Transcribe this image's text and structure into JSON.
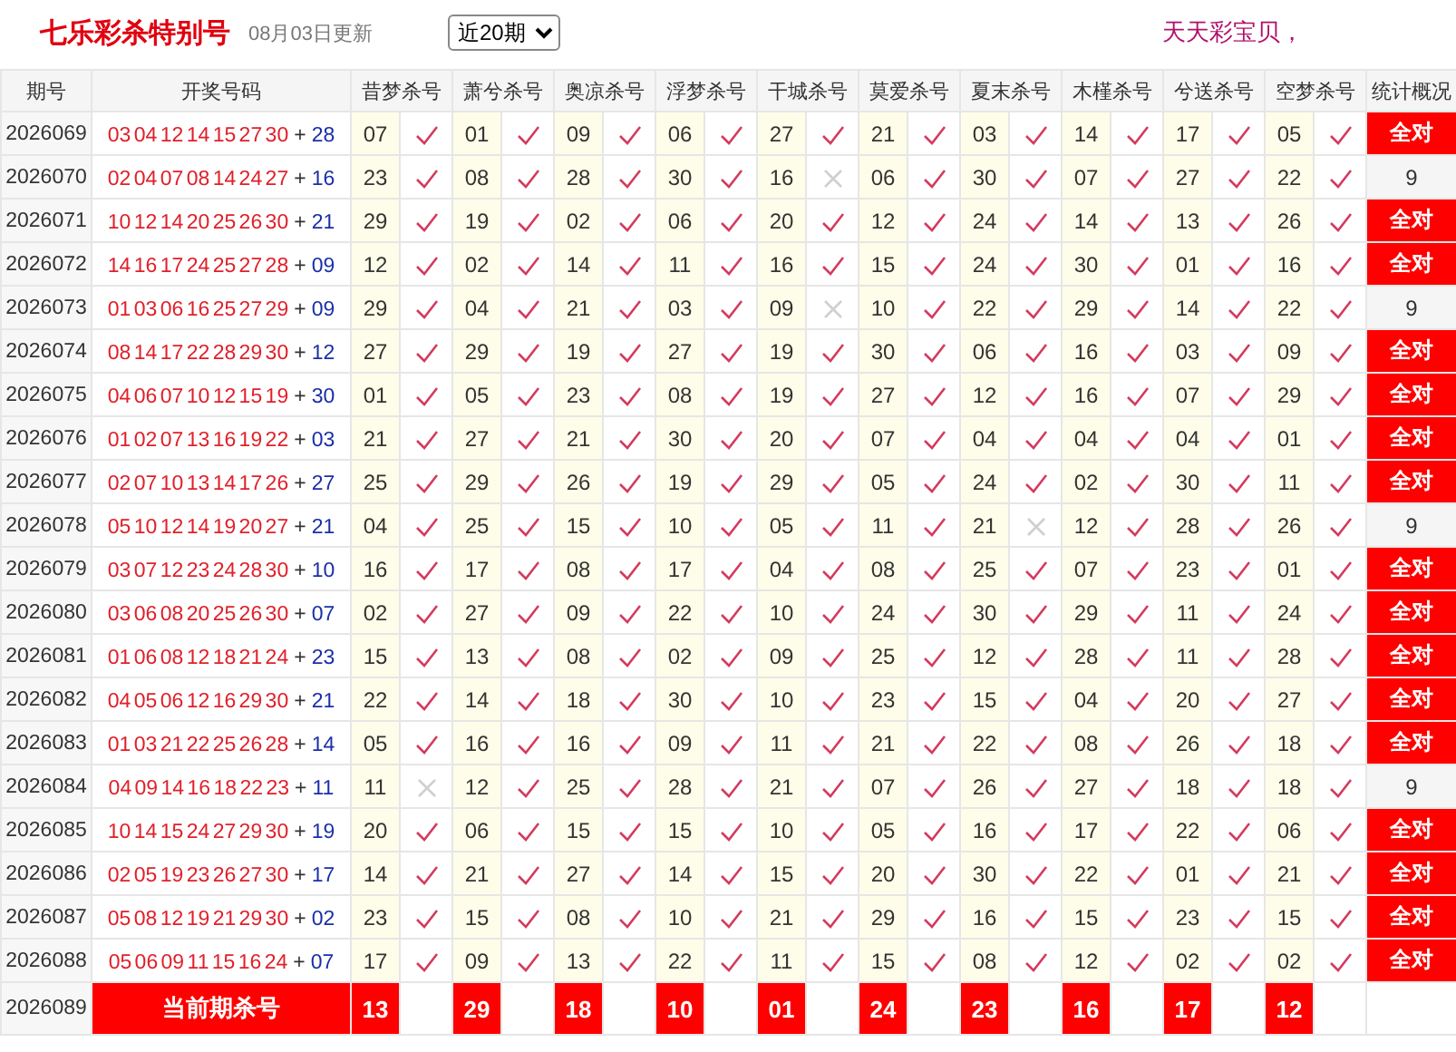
{
  "header": {
    "title": "七乐彩杀特别号",
    "updated": "08月03日更新",
    "period_select": "近20期",
    "slogan": "天天彩宝贝，"
  },
  "columns": [
    "期号",
    "开奖号码",
    "昔梦杀号",
    "萧兮杀号",
    "奥凉杀号",
    "浮梦杀号",
    "干城杀号",
    "莫爱杀号",
    "夏末杀号",
    "木槿杀号",
    "兮送杀号",
    "空梦杀号",
    "统计概况"
  ],
  "rows": [
    {
      "issue": "2026069",
      "main": "03 04 12 14 15 27 30",
      "plus": "+",
      "special": "28",
      "kills": [
        {
          "num": "07",
          "hit": true
        },
        {
          "num": "01",
          "hit": true
        },
        {
          "num": "09",
          "hit": true
        },
        {
          "num": "06",
          "hit": true
        },
        {
          "num": "27",
          "hit": true
        },
        {
          "num": "21",
          "hit": true
        },
        {
          "num": "03",
          "hit": true
        },
        {
          "num": "14",
          "hit": true
        },
        {
          "num": "17",
          "hit": true
        },
        {
          "num": "05",
          "hit": true
        }
      ],
      "summary": {
        "kind": "all",
        "text": "全对"
      }
    },
    {
      "issue": "2026070",
      "main": "02 04 07 08 14 24 27",
      "plus": "+",
      "special": "16",
      "kills": [
        {
          "num": "23",
          "hit": true
        },
        {
          "num": "08",
          "hit": true
        },
        {
          "num": "28",
          "hit": true
        },
        {
          "num": "30",
          "hit": true
        },
        {
          "num": "16",
          "hit": false
        },
        {
          "num": "06",
          "hit": true
        },
        {
          "num": "30",
          "hit": true
        },
        {
          "num": "07",
          "hit": true
        },
        {
          "num": "27",
          "hit": true
        },
        {
          "num": "22",
          "hit": true
        }
      ],
      "summary": {
        "kind": "count",
        "text": "9"
      }
    },
    {
      "issue": "2026071",
      "main": "10 12 14 20 25 26 30",
      "plus": "+",
      "special": "21",
      "kills": [
        {
          "num": "29",
          "hit": true
        },
        {
          "num": "19",
          "hit": true
        },
        {
          "num": "02",
          "hit": true
        },
        {
          "num": "06",
          "hit": true
        },
        {
          "num": "20",
          "hit": true
        },
        {
          "num": "12",
          "hit": true
        },
        {
          "num": "24",
          "hit": true
        },
        {
          "num": "14",
          "hit": true
        },
        {
          "num": "13",
          "hit": true
        },
        {
          "num": "26",
          "hit": true
        }
      ],
      "summary": {
        "kind": "all",
        "text": "全对"
      }
    },
    {
      "issue": "2026072",
      "main": "14 16 17 24 25 27 28",
      "plus": "+",
      "special": "09",
      "kills": [
        {
          "num": "12",
          "hit": true
        },
        {
          "num": "02",
          "hit": true
        },
        {
          "num": "14",
          "hit": true
        },
        {
          "num": "11",
          "hit": true
        },
        {
          "num": "16",
          "hit": true
        },
        {
          "num": "15",
          "hit": true
        },
        {
          "num": "24",
          "hit": true
        },
        {
          "num": "30",
          "hit": true
        },
        {
          "num": "01",
          "hit": true
        },
        {
          "num": "16",
          "hit": true
        }
      ],
      "summary": {
        "kind": "all",
        "text": "全对"
      }
    },
    {
      "issue": "2026073",
      "main": "01 03 06 16 25 27 29",
      "plus": "+",
      "special": "09",
      "kills": [
        {
          "num": "29",
          "hit": true
        },
        {
          "num": "04",
          "hit": true
        },
        {
          "num": "21",
          "hit": true
        },
        {
          "num": "03",
          "hit": true
        },
        {
          "num": "09",
          "hit": false
        },
        {
          "num": "10",
          "hit": true
        },
        {
          "num": "22",
          "hit": true
        },
        {
          "num": "29",
          "hit": true
        },
        {
          "num": "14",
          "hit": true
        },
        {
          "num": "22",
          "hit": true
        }
      ],
      "summary": {
        "kind": "count",
        "text": "9"
      }
    },
    {
      "issue": "2026074",
      "main": "08 14 17 22 28 29 30",
      "plus": "+",
      "special": "12",
      "kills": [
        {
          "num": "27",
          "hit": true
        },
        {
          "num": "29",
          "hit": true
        },
        {
          "num": "19",
          "hit": true
        },
        {
          "num": "27",
          "hit": true
        },
        {
          "num": "19",
          "hit": true
        },
        {
          "num": "30",
          "hit": true
        },
        {
          "num": "06",
          "hit": true
        },
        {
          "num": "16",
          "hit": true
        },
        {
          "num": "03",
          "hit": true
        },
        {
          "num": "09",
          "hit": true
        }
      ],
      "summary": {
        "kind": "all",
        "text": "全对"
      }
    },
    {
      "issue": "2026075",
      "main": "04 06 07 10 12 15 19",
      "plus": "+",
      "special": "30",
      "kills": [
        {
          "num": "01",
          "hit": true
        },
        {
          "num": "05",
          "hit": true
        },
        {
          "num": "23",
          "hit": true
        },
        {
          "num": "08",
          "hit": true
        },
        {
          "num": "19",
          "hit": true
        },
        {
          "num": "27",
          "hit": true
        },
        {
          "num": "12",
          "hit": true
        },
        {
          "num": "16",
          "hit": true
        },
        {
          "num": "07",
          "hit": true
        },
        {
          "num": "29",
          "hit": true
        }
      ],
      "summary": {
        "kind": "all",
        "text": "全对"
      }
    },
    {
      "issue": "2026076",
      "main": "01 02 07 13 16 19 22",
      "plus": "+",
      "special": "03",
      "kills": [
        {
          "num": "21",
          "hit": true
        },
        {
          "num": "27",
          "hit": true
        },
        {
          "num": "21",
          "hit": true
        },
        {
          "num": "30",
          "hit": true
        },
        {
          "num": "20",
          "hit": true
        },
        {
          "num": "07",
          "hit": true
        },
        {
          "num": "04",
          "hit": true
        },
        {
          "num": "04",
          "hit": true
        },
        {
          "num": "04",
          "hit": true
        },
        {
          "num": "01",
          "hit": true
        }
      ],
      "summary": {
        "kind": "all",
        "text": "全对"
      }
    },
    {
      "issue": "2026077",
      "main": "02 07 10 13 14 17 26",
      "plus": "+",
      "special": "27",
      "kills": [
        {
          "num": "25",
          "hit": true
        },
        {
          "num": "29",
          "hit": true
        },
        {
          "num": "26",
          "hit": true
        },
        {
          "num": "19",
          "hit": true
        },
        {
          "num": "29",
          "hit": true
        },
        {
          "num": "05",
          "hit": true
        },
        {
          "num": "24",
          "hit": true
        },
        {
          "num": "02",
          "hit": true
        },
        {
          "num": "30",
          "hit": true
        },
        {
          "num": "11",
          "hit": true
        }
      ],
      "summary": {
        "kind": "all",
        "text": "全对"
      }
    },
    {
      "issue": "2026078",
      "main": "05 10 12 14 19 20 27",
      "plus": "+",
      "special": "21",
      "kills": [
        {
          "num": "04",
          "hit": true
        },
        {
          "num": "25",
          "hit": true
        },
        {
          "num": "15",
          "hit": true
        },
        {
          "num": "10",
          "hit": true
        },
        {
          "num": "05",
          "hit": true
        },
        {
          "num": "11",
          "hit": true
        },
        {
          "num": "21",
          "hit": false
        },
        {
          "num": "12",
          "hit": true
        },
        {
          "num": "28",
          "hit": true
        },
        {
          "num": "26",
          "hit": true
        }
      ],
      "summary": {
        "kind": "count",
        "text": "9"
      }
    },
    {
      "issue": "2026079",
      "main": "03 07 12 23 24 28 30",
      "plus": "+",
      "special": "10",
      "kills": [
        {
          "num": "16",
          "hit": true
        },
        {
          "num": "17",
          "hit": true
        },
        {
          "num": "08",
          "hit": true
        },
        {
          "num": "17",
          "hit": true
        },
        {
          "num": "04",
          "hit": true
        },
        {
          "num": "08",
          "hit": true
        },
        {
          "num": "25",
          "hit": true
        },
        {
          "num": "07",
          "hit": true
        },
        {
          "num": "23",
          "hit": true
        },
        {
          "num": "01",
          "hit": true
        }
      ],
      "summary": {
        "kind": "all",
        "text": "全对"
      }
    },
    {
      "issue": "2026080",
      "main": "03 06 08 20 25 26 30",
      "plus": "+",
      "special": "07",
      "kills": [
        {
          "num": "02",
          "hit": true
        },
        {
          "num": "27",
          "hit": true
        },
        {
          "num": "09",
          "hit": true
        },
        {
          "num": "22",
          "hit": true
        },
        {
          "num": "10",
          "hit": true
        },
        {
          "num": "24",
          "hit": true
        },
        {
          "num": "30",
          "hit": true
        },
        {
          "num": "29",
          "hit": true
        },
        {
          "num": "11",
          "hit": true
        },
        {
          "num": "24",
          "hit": true
        }
      ],
      "summary": {
        "kind": "all",
        "text": "全对"
      }
    },
    {
      "issue": "2026081",
      "main": "01 06 08 12 18 21 24",
      "plus": "+",
      "special": "23",
      "kills": [
        {
          "num": "15",
          "hit": true
        },
        {
          "num": "13",
          "hit": true
        },
        {
          "num": "08",
          "hit": true
        },
        {
          "num": "02",
          "hit": true
        },
        {
          "num": "09",
          "hit": true
        },
        {
          "num": "25",
          "hit": true
        },
        {
          "num": "12",
          "hit": true
        },
        {
          "num": "28",
          "hit": true
        },
        {
          "num": "11",
          "hit": true
        },
        {
          "num": "28",
          "hit": true
        }
      ],
      "summary": {
        "kind": "all",
        "text": "全对"
      }
    },
    {
      "issue": "2026082",
      "main": "04 05 06 12 16 29 30",
      "plus": "+",
      "special": "21",
      "kills": [
        {
          "num": "22",
          "hit": true
        },
        {
          "num": "14",
          "hit": true
        },
        {
          "num": "18",
          "hit": true
        },
        {
          "num": "30",
          "hit": true
        },
        {
          "num": "10",
          "hit": true
        },
        {
          "num": "23",
          "hit": true
        },
        {
          "num": "15",
          "hit": true
        },
        {
          "num": "04",
          "hit": true
        },
        {
          "num": "20",
          "hit": true
        },
        {
          "num": "27",
          "hit": true
        }
      ],
      "summary": {
        "kind": "all",
        "text": "全对"
      }
    },
    {
      "issue": "2026083",
      "main": "01 03 21 22 25 26 28",
      "plus": "+",
      "special": "14",
      "kills": [
        {
          "num": "05",
          "hit": true
        },
        {
          "num": "16",
          "hit": true
        },
        {
          "num": "16",
          "hit": true
        },
        {
          "num": "09",
          "hit": true
        },
        {
          "num": "11",
          "hit": true
        },
        {
          "num": "21",
          "hit": true
        },
        {
          "num": "22",
          "hit": true
        },
        {
          "num": "08",
          "hit": true
        },
        {
          "num": "26",
          "hit": true
        },
        {
          "num": "18",
          "hit": true
        }
      ],
      "summary": {
        "kind": "all",
        "text": "全对"
      }
    },
    {
      "issue": "2026084",
      "main": "04 09 14 16 18 22 23",
      "plus": "+",
      "special": "11",
      "kills": [
        {
          "num": "11",
          "hit": false
        },
        {
          "num": "12",
          "hit": true
        },
        {
          "num": "25",
          "hit": true
        },
        {
          "num": "28",
          "hit": true
        },
        {
          "num": "21",
          "hit": true
        },
        {
          "num": "07",
          "hit": true
        },
        {
          "num": "26",
          "hit": true
        },
        {
          "num": "27",
          "hit": true
        },
        {
          "num": "18",
          "hit": true
        },
        {
          "num": "18",
          "hit": true
        }
      ],
      "summary": {
        "kind": "count",
        "text": "9"
      }
    },
    {
      "issue": "2026085",
      "main": "10 14 15 24 27 29 30",
      "plus": "+",
      "special": "19",
      "kills": [
        {
          "num": "20",
          "hit": true
        },
        {
          "num": "06",
          "hit": true
        },
        {
          "num": "15",
          "hit": true
        },
        {
          "num": "15",
          "hit": true
        },
        {
          "num": "10",
          "hit": true
        },
        {
          "num": "05",
          "hit": true
        },
        {
          "num": "16",
          "hit": true
        },
        {
          "num": "17",
          "hit": true
        },
        {
          "num": "22",
          "hit": true
        },
        {
          "num": "06",
          "hit": true
        }
      ],
      "summary": {
        "kind": "all",
        "text": "全对"
      }
    },
    {
      "issue": "2026086",
      "main": "02 05 19 23 26 27 30",
      "plus": "+",
      "special": "17",
      "kills": [
        {
          "num": "14",
          "hit": true
        },
        {
          "num": "21",
          "hit": true
        },
        {
          "num": "27",
          "hit": true
        },
        {
          "num": "14",
          "hit": true
        },
        {
          "num": "15",
          "hit": true
        },
        {
          "num": "20",
          "hit": true
        },
        {
          "num": "30",
          "hit": true
        },
        {
          "num": "22",
          "hit": true
        },
        {
          "num": "01",
          "hit": true
        },
        {
          "num": "21",
          "hit": true
        }
      ],
      "summary": {
        "kind": "all",
        "text": "全对"
      }
    },
    {
      "issue": "2026087",
      "main": "05 08 12 19 21 29 30",
      "plus": "+",
      "special": "02",
      "kills": [
        {
          "num": "23",
          "hit": true
        },
        {
          "num": "15",
          "hit": true
        },
        {
          "num": "08",
          "hit": true
        },
        {
          "num": "10",
          "hit": true
        },
        {
          "num": "21",
          "hit": true
        },
        {
          "num": "29",
          "hit": true
        },
        {
          "num": "16",
          "hit": true
        },
        {
          "num": "15",
          "hit": true
        },
        {
          "num": "23",
          "hit": true
        },
        {
          "num": "15",
          "hit": true
        }
      ],
      "summary": {
        "kind": "all",
        "text": "全对"
      }
    },
    {
      "issue": "2026088",
      "main": "05 06 09 11 15 16 24",
      "plus": "+",
      "special": "07",
      "kills": [
        {
          "num": "17",
          "hit": true
        },
        {
          "num": "09",
          "hit": true
        },
        {
          "num": "13",
          "hit": true
        },
        {
          "num": "22",
          "hit": true
        },
        {
          "num": "11",
          "hit": true
        },
        {
          "num": "15",
          "hit": true
        },
        {
          "num": "08",
          "hit": true
        },
        {
          "num": "12",
          "hit": true
        },
        {
          "num": "02",
          "hit": true
        },
        {
          "num": "02",
          "hit": true
        }
      ],
      "summary": {
        "kind": "all",
        "text": "全对"
      }
    }
  ],
  "current": {
    "issue": "2026089",
    "label": "当前期杀号",
    "kills": [
      "13",
      "29",
      "18",
      "10",
      "01",
      "24",
      "23",
      "16",
      "17",
      "12"
    ]
  }
}
